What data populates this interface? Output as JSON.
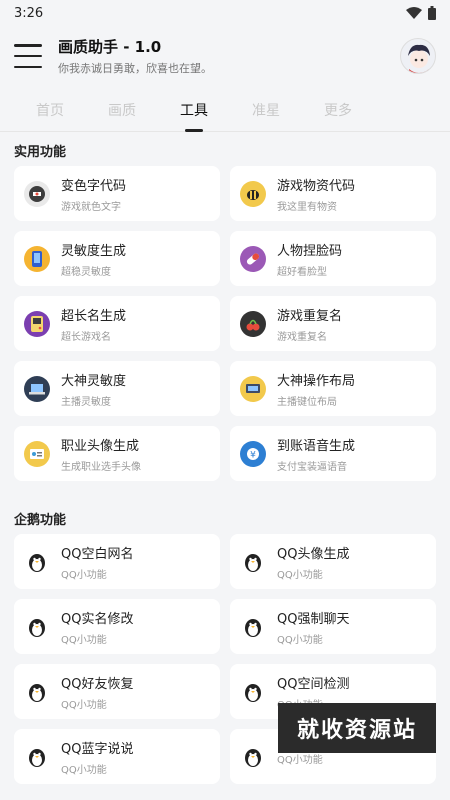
{
  "status": {
    "time": "3:26"
  },
  "app": {
    "title": "画质助手 - 1.0",
    "subtitle": "你我赤诚日勇敢，欣喜也在望。"
  },
  "tabs": [
    {
      "label": "首页"
    },
    {
      "label": "画质"
    },
    {
      "label": "工具"
    },
    {
      "label": "准星"
    },
    {
      "label": "更多"
    }
  ],
  "sections": {
    "utility": {
      "title": "实用功能",
      "items": [
        {
          "title": "变色字代码",
          "sub": "游戏就色文字",
          "icon": "color-text-icon",
          "color": "#3d3d3d"
        },
        {
          "title": "游戏物资代码",
          "sub": "我这里有物资",
          "icon": "bee-icon",
          "color": "#f2c94c"
        },
        {
          "title": "灵敏度生成",
          "sub": "超稳灵敏度",
          "icon": "phone-icon",
          "color": "#f5b431"
        },
        {
          "title": "人物捏脸码",
          "sub": "超好看脸型",
          "icon": "capsule-icon",
          "color": "#9b59b6"
        },
        {
          "title": "超长名生成",
          "sub": "超长游戏名",
          "icon": "gameboy-icon",
          "color": "#7b3fb0"
        },
        {
          "title": "游戏重复名",
          "sub": "游戏重复名",
          "icon": "cherries-icon",
          "color": "#333333"
        },
        {
          "title": "大神灵敏度",
          "sub": "主播灵敏度",
          "icon": "laptop-icon",
          "color": "#2f80c8"
        },
        {
          "title": "大神操作布局",
          "sub": "主播键位布局",
          "icon": "layout-icon",
          "color": "#f2c94c"
        },
        {
          "title": "职业头像生成",
          "sub": "生成职业选手头像",
          "icon": "id-card-icon",
          "color": "#f2c94c"
        },
        {
          "title": "到账语音生成",
          "sub": "支付宝装逼语音",
          "icon": "payment-icon",
          "color": "#2d7fd3"
        }
      ]
    },
    "qq": {
      "title": "企鹅功能",
      "items": [
        {
          "title": "QQ空白网名",
          "sub": "QQ小功能",
          "icon": "penguin-icon"
        },
        {
          "title": "QQ头像生成",
          "sub": "QQ小功能",
          "icon": "penguin-icon"
        },
        {
          "title": "QQ实名修改",
          "sub": "QQ小功能",
          "icon": "penguin-icon"
        },
        {
          "title": "QQ强制聊天",
          "sub": "QQ小功能",
          "icon": "penguin-icon"
        },
        {
          "title": "QQ好友恢复",
          "sub": "QQ小功能",
          "icon": "penguin-icon"
        },
        {
          "title": "QQ空间检测",
          "sub": "QQ小功能",
          "icon": "penguin-icon"
        },
        {
          "title": "QQ蓝字说说",
          "sub": "QQ小功能",
          "icon": "penguin-icon"
        },
        {
          "title": "",
          "sub": "QQ小功能",
          "icon": "penguin-icon"
        }
      ]
    }
  },
  "watermark": "就收资源站"
}
